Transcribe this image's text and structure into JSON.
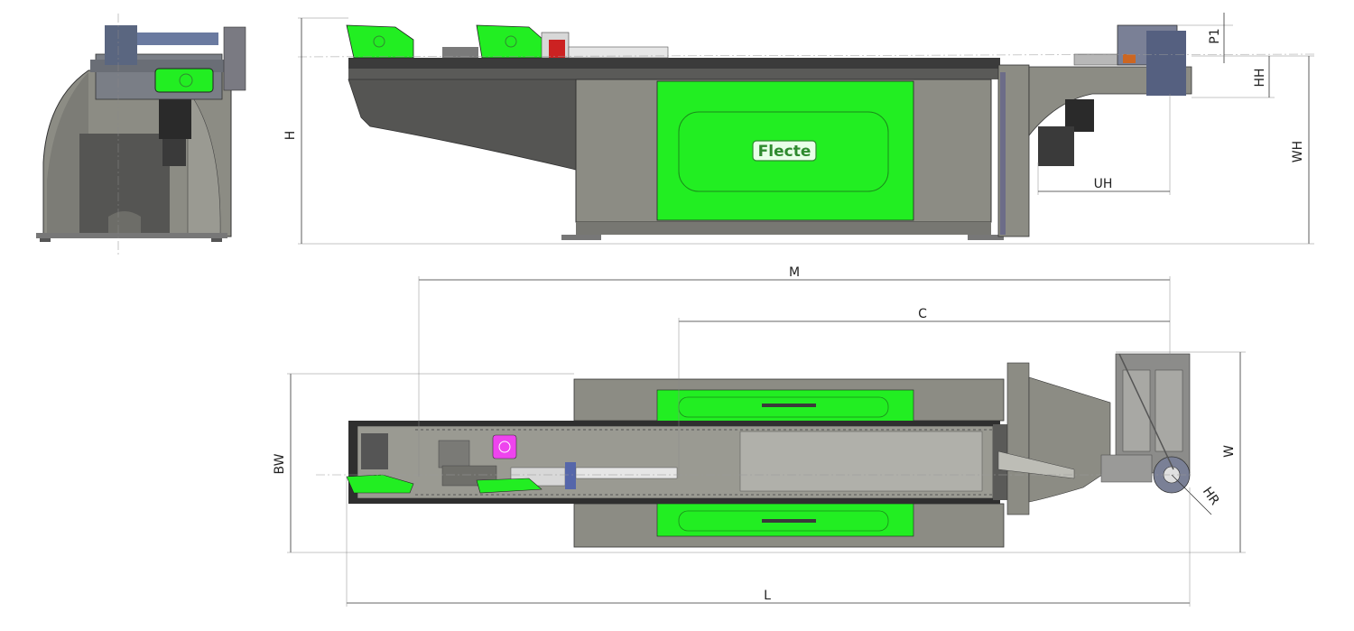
{
  "dimensions": {
    "H": "H",
    "P1": "P1",
    "HH": "HH",
    "WH": "WH",
    "UH": "UH",
    "M": "M",
    "C": "C",
    "BW": "BW",
    "W": "W",
    "HR": "HR",
    "L": "L"
  },
  "logo": {
    "text": "Flecte"
  },
  "colors": {
    "accent_green": "#22ee22",
    "body_gray": "#8c8c84",
    "dark_gray": "#555553",
    "frame_dark": "#3b3b3b",
    "magenta": "#ee44ee"
  }
}
